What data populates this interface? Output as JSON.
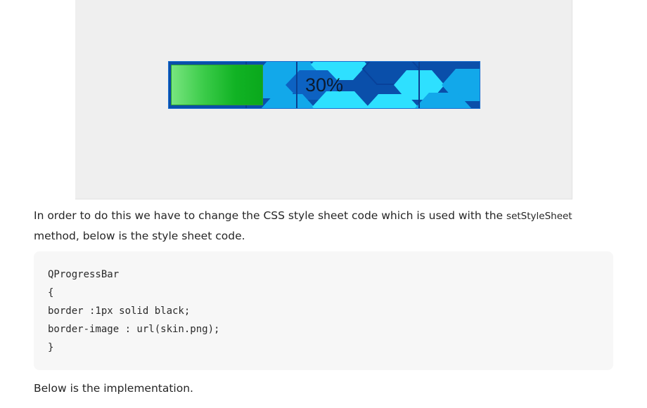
{
  "demo": {
    "progress_value": 0.3,
    "progress_text": "30%",
    "colors": {
      "panel_background": "#efefef",
      "bar_background": "#0a4faa",
      "hex_light": "#2ee0ff",
      "hex_mid": "#12a8ea",
      "chunk_green": "#11b324"
    }
  },
  "article": {
    "intro_before": "In order to do this we have to change the CSS style sheet code which is used with the ",
    "inline_code": "setStyleSheet",
    "intro_after": " method, below is the style sheet code.",
    "code_lines": [
      "QProgressBar",
      "{",
      "border :1px solid black;",
      "border-image : url(skin.png);",
      "}"
    ],
    "outro": "Below is the implementation."
  }
}
